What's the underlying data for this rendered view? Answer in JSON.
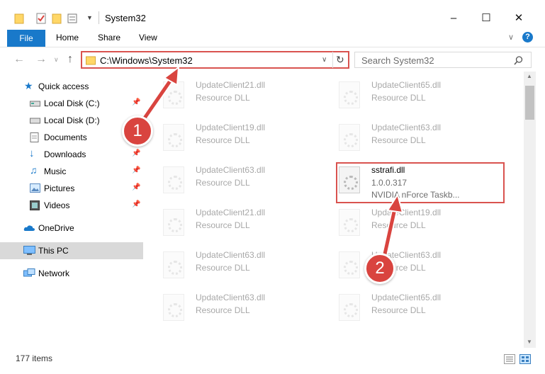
{
  "window": {
    "title": "System32"
  },
  "ribbon": {
    "file": "File",
    "home": "Home",
    "share": "Share",
    "view": "View"
  },
  "address": {
    "path": "C:\\Windows\\System32"
  },
  "search": {
    "placeholder": "Search System32"
  },
  "sidebar": {
    "items": [
      {
        "label": "Quick access",
        "icon": "star-icon"
      },
      {
        "label": "Local Disk (C:)",
        "icon": "drive-icon"
      },
      {
        "label": "Local Disk (D:)",
        "icon": "drive-icon"
      },
      {
        "label": "Documents",
        "icon": "documents-icon"
      },
      {
        "label": "Downloads",
        "icon": "downloads-icon"
      },
      {
        "label": "Music",
        "icon": "music-icon"
      },
      {
        "label": "Pictures",
        "icon": "pictures-icon"
      },
      {
        "label": "Videos",
        "icon": "videos-icon"
      },
      {
        "label": "OneDrive",
        "icon": "cloud-icon"
      },
      {
        "label": "This PC",
        "icon": "computer-icon"
      },
      {
        "label": "Network",
        "icon": "network-icon"
      }
    ]
  },
  "files": [
    {
      "name": "UpdateClient21.dll",
      "sub": "Resource DLL"
    },
    {
      "name": "UpdateClient65.dll",
      "sub": "Resource DLL"
    },
    {
      "name": "UpdateClient19.dll",
      "sub": "Resource DLL"
    },
    {
      "name": "UpdateClient63.dll",
      "sub": "Resource DLL"
    },
    {
      "name": "UpdateClient63.dll",
      "sub": "Resource DLL"
    },
    {
      "name": "sstrafi.dll",
      "sub": "1.0.0.317",
      "desc": "NVIDIA nForce Taskb..."
    },
    {
      "name": "UpdateClient21.dll",
      "sub": "Resource DLL"
    },
    {
      "name": "UpdateClient19.dll",
      "sub": "Resource DLL"
    },
    {
      "name": "UpdateClient63.dll",
      "sub": "Resource DLL"
    },
    {
      "name": "UpdateClient63.dll",
      "sub": "Resource DLL"
    },
    {
      "name": "UpdateClient63.dll",
      "sub": "Resource DLL"
    },
    {
      "name": "UpdateClient65.dll",
      "sub": "Resource DLL"
    }
  ],
  "status": {
    "count": "177 items"
  },
  "annotations": {
    "step1": "1",
    "step2": "2"
  },
  "colors": {
    "accent": "#1979ca",
    "highlight": "#d9534f",
    "badge": "#d9443f",
    "selected": "#cce8ff"
  }
}
